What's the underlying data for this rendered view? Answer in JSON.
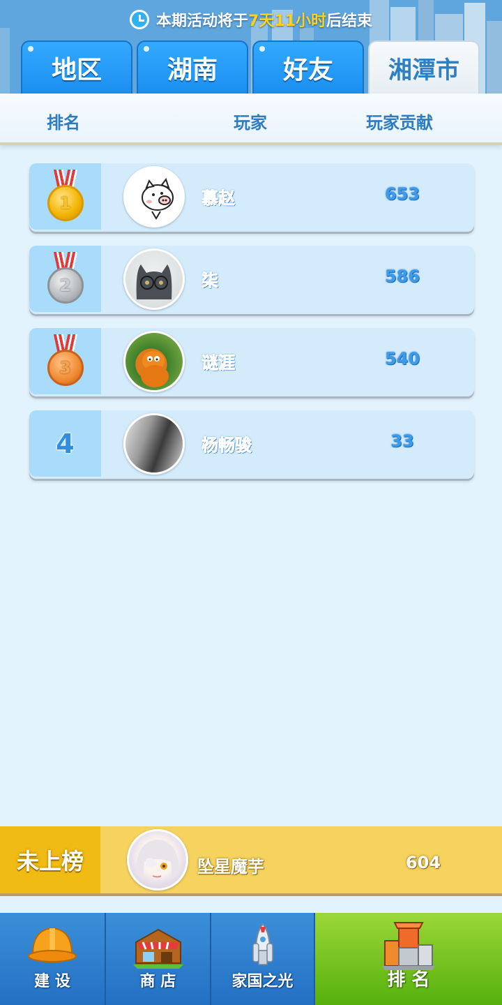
{
  "banner": {
    "text_before": "本期活动将于",
    "time_left": "7天11小时",
    "text_after": "后结束"
  },
  "tabs": [
    {
      "label": "地区",
      "active": false
    },
    {
      "label": "湖南",
      "active": false
    },
    {
      "label": "好友",
      "active": false
    },
    {
      "label": "湘潭市",
      "active": true
    }
  ],
  "columns": {
    "rank": "排名",
    "player": "玩家",
    "contribution": "玩家贡献"
  },
  "rows": [
    {
      "rank": "1",
      "medal": "gold-medal-icon",
      "name": "慕赵",
      "score": "653",
      "avatar": "pig-avatar"
    },
    {
      "rank": "2",
      "medal": "silver-medal-icon",
      "name": "柒",
      "score": "586",
      "avatar": "cat-avatar"
    },
    {
      "rank": "3",
      "medal": "bronze-medal-icon",
      "name": "谜涯",
      "score": "540",
      "avatar": "garfield-avatar"
    },
    {
      "rank": "4",
      "medal": null,
      "name": "杨畅骏",
      "score": "33",
      "avatar": "portrait-avatar"
    }
  ],
  "me": {
    "tag": "未上榜",
    "name": "坠星魔芋",
    "score": "604",
    "avatar": "anime-girl-avatar"
  },
  "nav": [
    {
      "label": "建 设",
      "icon": "hard-hat-icon",
      "active": false
    },
    {
      "label": "商 店",
      "icon": "shop-icon",
      "active": false
    },
    {
      "label": "家国之光",
      "icon": "rocket-icon",
      "active": false
    },
    {
      "label": "排 名",
      "icon": "podium-icon",
      "active": true
    }
  ],
  "colors": {
    "tab_blue": "#1a8ff0",
    "highlight_yellow": "#ffd21f",
    "me_row": "#f6d25e",
    "nav_active": "#56b00c"
  }
}
